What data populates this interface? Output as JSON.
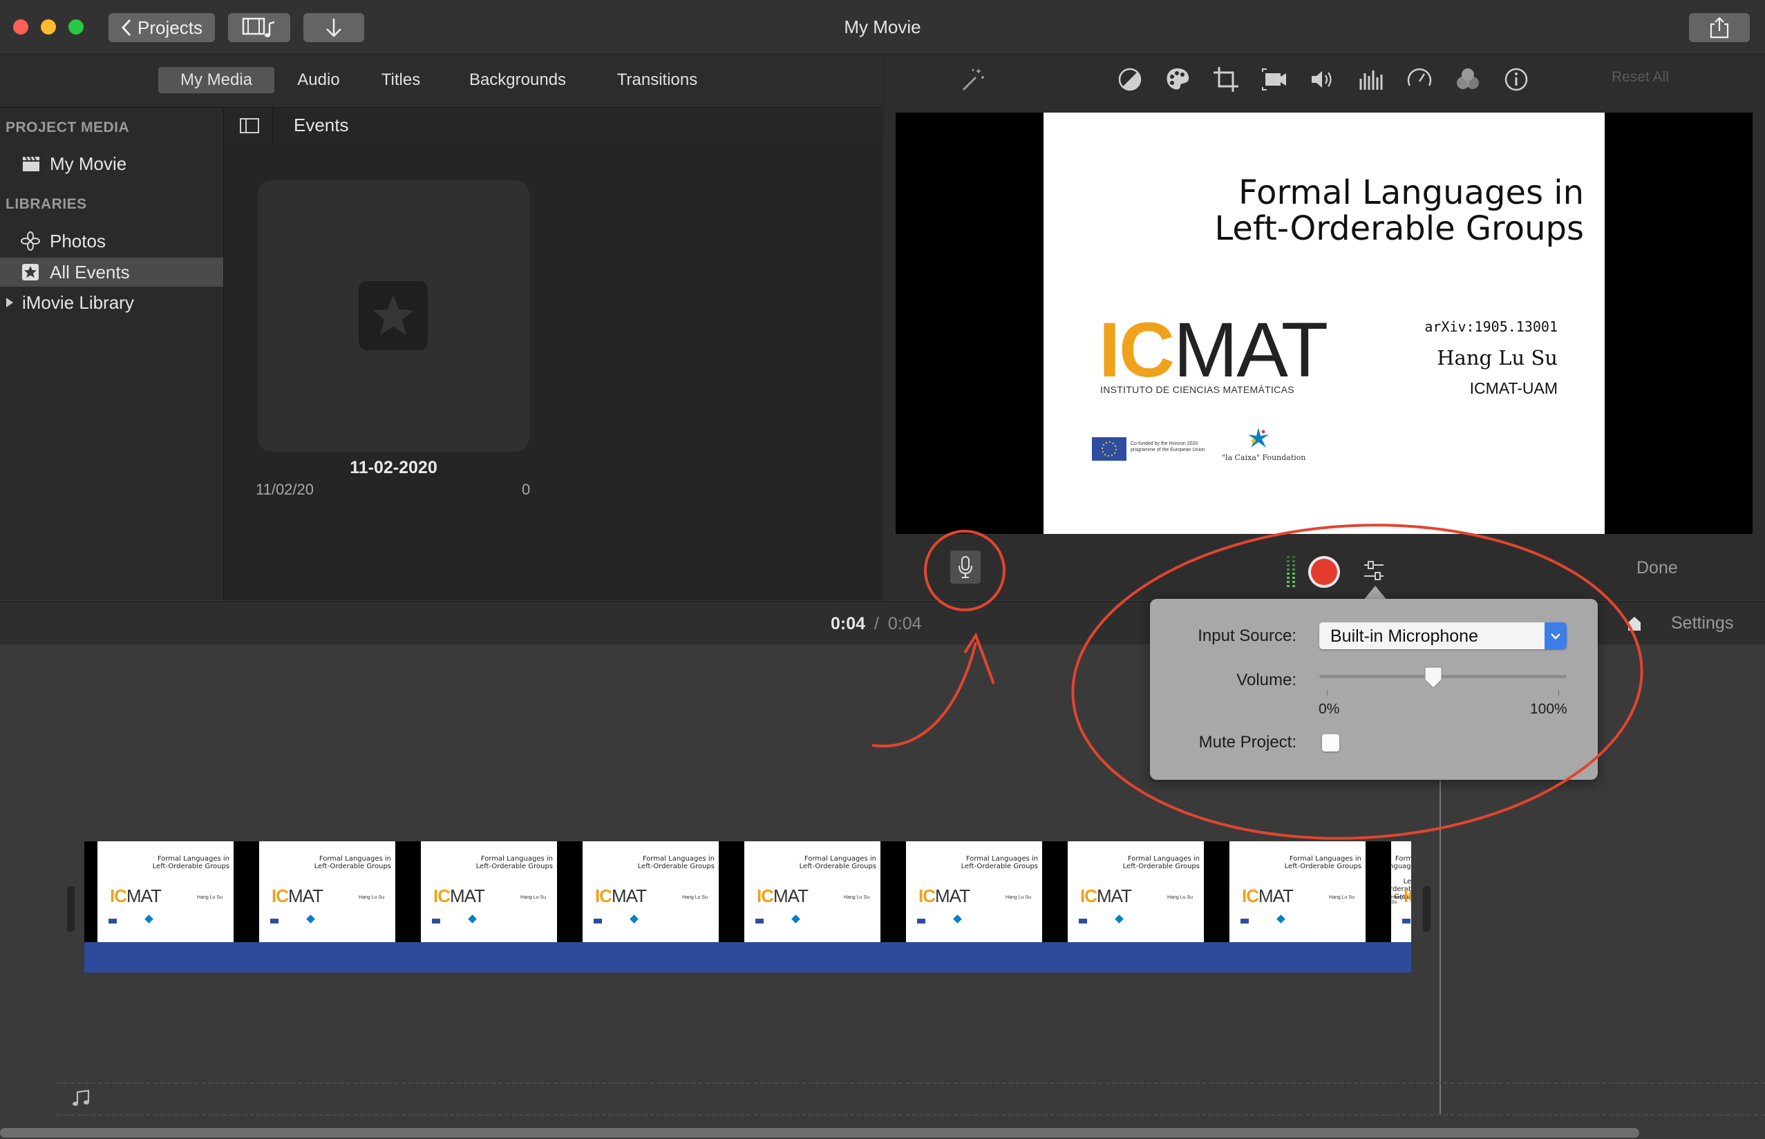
{
  "window": {
    "title": "My Movie"
  },
  "toolbar": {
    "projects_label": "Projects"
  },
  "media_tabs": [
    {
      "label": "My Media",
      "active": true
    },
    {
      "label": "Audio"
    },
    {
      "label": "Titles"
    },
    {
      "label": "Backgrounds"
    },
    {
      "label": "Transitions"
    }
  ],
  "sidebar": {
    "project_media_header": "PROJECT MEDIA",
    "project_item": "My Movie",
    "libraries_header": "LIBRARIES",
    "libraries": [
      {
        "label": "Photos"
      },
      {
        "label": "All Events",
        "selected": true
      },
      {
        "label": "iMovie Library"
      }
    ]
  },
  "events": {
    "header": "Events",
    "card": {
      "title": "11-02-2020",
      "date": "11/02/20",
      "count": "0"
    }
  },
  "viewer": {
    "reset_all": "Reset All",
    "done": "Done",
    "slide": {
      "title_line1": "Formal Languages in",
      "title_line2": "Left-Orderable Groups",
      "arxiv": "arXiv:1905.13001",
      "author": "Hang Lu Su",
      "affiliation": "ICMAT-UAM",
      "logo_text": "ICMAT",
      "logo_sub": "INSTITUTO DE CIENCIAS MATEMÁTICAS",
      "eu_text": "Co-funded by the Horizon 2020 programme of the European Union",
      "lacaixa_text": "\"la Caixa\" Foundation"
    }
  },
  "timeline": {
    "current_time": "0:04",
    "separator": "/",
    "total_time": "0:04",
    "settings": "Settings"
  },
  "voiceover": {
    "input_source_label": "Input Source:",
    "input_source_value": "Built-in Microphone",
    "volume_label": "Volume:",
    "volume_min": "0%",
    "volume_max": "100%",
    "volume_level": 0.46,
    "mute_label": "Mute Project:",
    "mute_checked": false
  },
  "colors": {
    "annotation": "#e0452f",
    "record": "#e53b2c",
    "icmat_orange": "#f0a21c",
    "audio_track": "#2e4a9a",
    "select_blue": "#3d7de8"
  }
}
